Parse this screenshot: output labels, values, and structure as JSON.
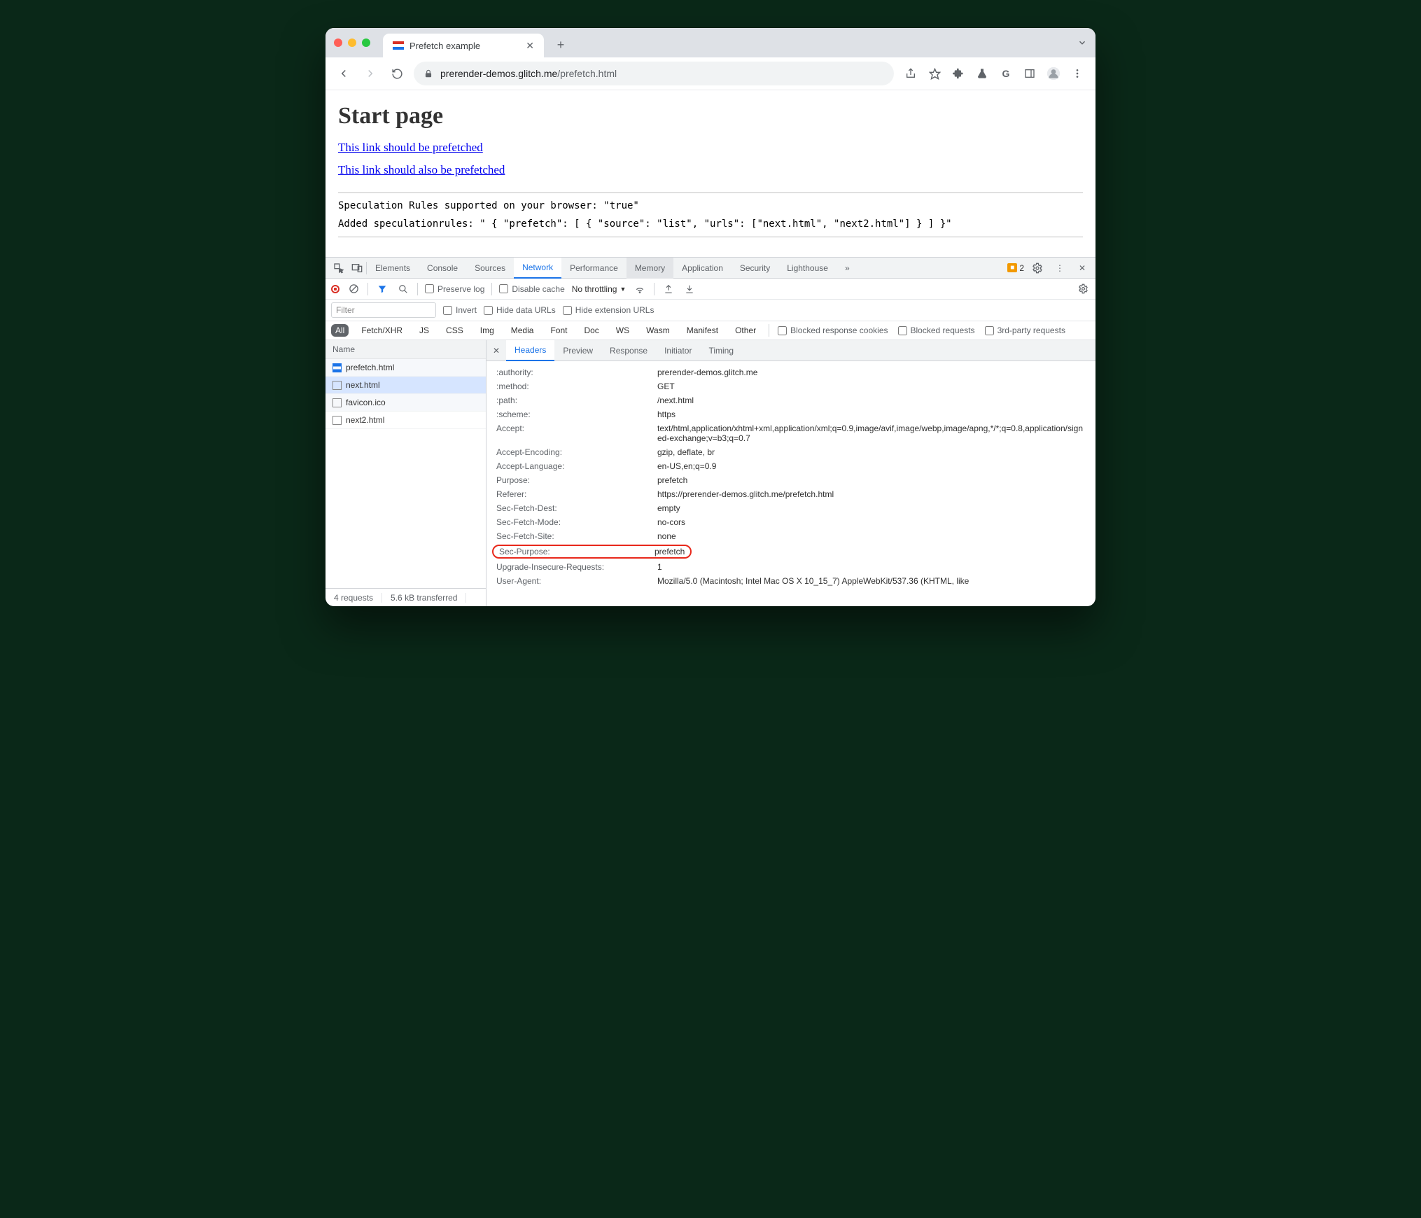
{
  "tab": {
    "title": "Prefetch example"
  },
  "url": {
    "host": "prerender-demos.glitch.me",
    "path": "/prefetch.html"
  },
  "page": {
    "heading": "Start page",
    "link1": "This link should be prefetched",
    "link2": "This link should also be prefetched",
    "line1": "Speculation Rules supported on your browser: \"true\"",
    "line2": "Added speculationrules: \" { \"prefetch\": [ { \"source\": \"list\", \"urls\": [\"next.html\", \"next2.html\"] } ] }\""
  },
  "devtools": {
    "tabs": [
      "Elements",
      "Console",
      "Sources",
      "Network",
      "Performance",
      "Memory",
      "Application",
      "Security",
      "Lighthouse"
    ],
    "active_tab": "Network",
    "hovered_tab": "Memory",
    "warn_count": "2",
    "toolbar": {
      "preserve_log": "Preserve log",
      "disable_cache": "Disable cache",
      "throttle": "No throttling"
    },
    "filter": {
      "placeholder": "Filter",
      "invert": "Invert",
      "hide_data": "Hide data URLs",
      "hide_ext": "Hide extension URLs"
    },
    "types": [
      "All",
      "Fetch/XHR",
      "JS",
      "CSS",
      "Img",
      "Media",
      "Font",
      "Doc",
      "WS",
      "Wasm",
      "Manifest",
      "Other"
    ],
    "type_checks": [
      "Blocked response cookies",
      "Blocked requests",
      "3rd-party requests"
    ],
    "request_list_header": "Name",
    "requests": [
      {
        "name": "prefetch.html",
        "type": "doc"
      },
      {
        "name": "next.html",
        "type": "plain",
        "selected": true
      },
      {
        "name": "favicon.ico",
        "type": "plain"
      },
      {
        "name": "next2.html",
        "type": "plain"
      }
    ],
    "detail_tabs": [
      "Headers",
      "Preview",
      "Response",
      "Initiator",
      "Timing"
    ],
    "detail_active": "Headers",
    "headers": [
      {
        "k": ":authority:",
        "v": "prerender-demos.glitch.me"
      },
      {
        "k": ":method:",
        "v": "GET"
      },
      {
        "k": ":path:",
        "v": "/next.html"
      },
      {
        "k": ":scheme:",
        "v": "https"
      },
      {
        "k": "Accept:",
        "v": "text/html,application/xhtml+xml,application/xml;q=0.9,image/avif,image/webp,image/apng,*/*;q=0.8,application/signed-exchange;v=b3;q=0.7"
      },
      {
        "k": "Accept-Encoding:",
        "v": "gzip, deflate, br"
      },
      {
        "k": "Accept-Language:",
        "v": "en-US,en;q=0.9"
      },
      {
        "k": "Purpose:",
        "v": "prefetch"
      },
      {
        "k": "Referer:",
        "v": "https://prerender-demos.glitch.me/prefetch.html"
      },
      {
        "k": "Sec-Fetch-Dest:",
        "v": "empty"
      },
      {
        "k": "Sec-Fetch-Mode:",
        "v": "no-cors"
      },
      {
        "k": "Sec-Fetch-Site:",
        "v": "none"
      },
      {
        "k": "Sec-Purpose:",
        "v": "prefetch",
        "highlight": true
      },
      {
        "k": "Upgrade-Insecure-Requests:",
        "v": "1"
      },
      {
        "k": "User-Agent:",
        "v": "Mozilla/5.0 (Macintosh; Intel Mac OS X 10_15_7) AppleWebKit/537.36 (KHTML, like"
      }
    ],
    "status": {
      "requests": "4 requests",
      "transferred": "5.6 kB transferred"
    }
  }
}
